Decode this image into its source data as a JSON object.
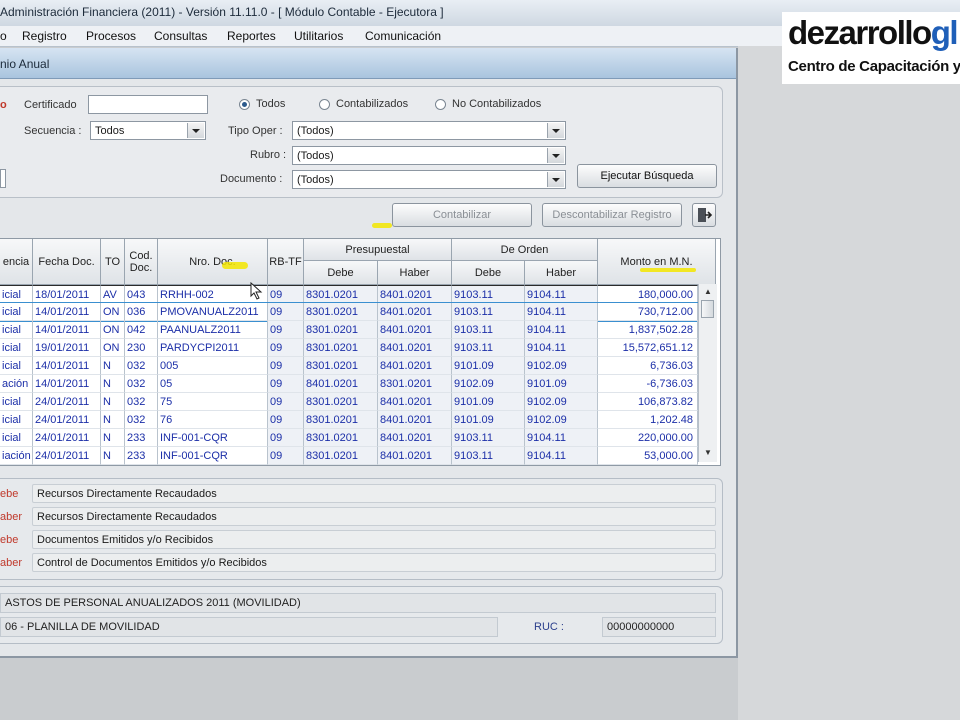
{
  "window": {
    "title": "Administración Financiera (2011) - Versión 11.11.0 - [ Módulo Contable - Ejecutora ]"
  },
  "menu": [
    "o",
    "Registro",
    "Procesos",
    "Consultas",
    "Reportes",
    "Utilitarios",
    "Comunicación"
  ],
  "child_window": {
    "title": "nio Anual"
  },
  "logo": {
    "main_a": "dezarrollo",
    "main_b": "gl",
    "sub": "Centro de Capacitación y"
  },
  "colors": {
    "cell_text": "#1c2fa8",
    "red_label": "#c0392b",
    "logo_accent": "#1f5fb8"
  },
  "filters": {
    "cut_label": "o",
    "certificado_label": "Certificado",
    "certificado_value": "",
    "secuencia_label": "Secuencia :",
    "secuencia_value": "Todos",
    "radio_todos": "Todos",
    "radio_contabilizados": "Contabilizados",
    "radio_no_contabilizados": "No Contabilizados",
    "tipo_oper_label": "Tipo Oper :",
    "tipo_oper_value": "(Todos)",
    "rubro_label": "Rubro :",
    "rubro_value": "(Todos)",
    "documento_label": "Documento :",
    "documento_value": "(Todos)",
    "search_button": "Ejecutar Búsqueda"
  },
  "actions": {
    "contabilizar": "Contabilizar",
    "descontabilizar": "Descontabilizar Registro"
  },
  "grid": {
    "headers": {
      "secuencia": "encia",
      "fecha_doc": "Fecha Doc.",
      "to": "TO",
      "cod_doc": "Cod. Doc.",
      "nro_doc": "Nro. Doc.",
      "rb_tf": "RB-TF",
      "presupuestal": "Presupuestal",
      "de_orden": "De Orden",
      "debe": "Debe",
      "haber": "Haber",
      "monto": "Monto en M.N."
    },
    "rows": [
      {
        "sec": "icial",
        "fecha": "18/01/2011",
        "to": "AV",
        "cod": "043",
        "nro": "RRHH-002",
        "rb": "09",
        "p_debe": "8301.0201",
        "p_haber": "8401.0201",
        "o_debe": "9103.11",
        "o_haber": "9104.11",
        "monto": "180,000.00"
      },
      {
        "sec": "icial",
        "fecha": "14/01/2011",
        "to": "ON",
        "cod": "036",
        "nro": "PMOVANUALZ2011",
        "rb": "09",
        "p_debe": "8301.0201",
        "p_haber": "8401.0201",
        "o_debe": "9103.11",
        "o_haber": "9104.11",
        "monto": "730,712.00"
      },
      {
        "sec": "icial",
        "fecha": "14/01/2011",
        "to": "ON",
        "cod": "042",
        "nro": "PAANUALZ2011",
        "rb": "09",
        "p_debe": "8301.0201",
        "p_haber": "8401.0201",
        "o_debe": "9103.11",
        "o_haber": "9104.11",
        "monto": "1,837,502.28"
      },
      {
        "sec": "icial",
        "fecha": "19/01/2011",
        "to": "ON",
        "cod": "230",
        "nro": "PARDYCPI2011",
        "rb": "09",
        "p_debe": "8301.0201",
        "p_haber": "8401.0201",
        "o_debe": "9103.11",
        "o_haber": "9104.11",
        "monto": "15,572,651.12"
      },
      {
        "sec": "icial",
        "fecha": "14/01/2011",
        "to": "N",
        "cod": "032",
        "nro": "005",
        "rb": "09",
        "p_debe": "8301.0201",
        "p_haber": "8401.0201",
        "o_debe": "9101.09",
        "o_haber": "9102.09",
        "monto": "6,736.03"
      },
      {
        "sec": "ación",
        "fecha": "14/01/2011",
        "to": "N",
        "cod": "032",
        "nro": "05",
        "rb": "09",
        "p_debe": "8401.0201",
        "p_haber": "8301.0201",
        "o_debe": "9102.09",
        "o_haber": "9101.09",
        "monto": "-6,736.03"
      },
      {
        "sec": "icial",
        "fecha": "24/01/2011",
        "to": "N",
        "cod": "032",
        "nro": "75",
        "rb": "09",
        "p_debe": "8301.0201",
        "p_haber": "8401.0201",
        "o_debe": "9101.09",
        "o_haber": "9102.09",
        "monto": "106,873.82"
      },
      {
        "sec": "icial",
        "fecha": "24/01/2011",
        "to": "N",
        "cod": "032",
        "nro": "76",
        "rb": "09",
        "p_debe": "8301.0201",
        "p_haber": "8401.0201",
        "o_debe": "9101.09",
        "o_haber": "9102.09",
        "monto": "1,202.48"
      },
      {
        "sec": "icial",
        "fecha": "24/01/2011",
        "to": "N",
        "cod": "233",
        "nro": "INF-001-CQR",
        "rb": "09",
        "p_debe": "8301.0201",
        "p_haber": "8401.0201",
        "o_debe": "9103.11",
        "o_haber": "9104.11",
        "monto": "220,000.00"
      },
      {
        "sec": "iación",
        "fecha": "24/01/2011",
        "to": "N",
        "cod": "233",
        "nro": "INF-001-CQR",
        "rb": "09",
        "p_debe": "8301.0201",
        "p_haber": "8401.0201",
        "o_debe": "9103.11",
        "o_haber": "9104.11",
        "monto": "53,000.00"
      }
    ]
  },
  "accounts": [
    {
      "type": "ebe",
      "desc": "Recursos Directamente Recaudados"
    },
    {
      "type": "aber",
      "desc": "Recursos Directamente Recaudados"
    },
    {
      "type": "ebe",
      "desc": "Documentos Emitidos y/o Recibidos"
    },
    {
      "type": "aber",
      "desc": "Control de Documentos Emitidos y/o Recibidos"
    }
  ],
  "info": {
    "line1": "ASTOS DE PERSONAL ANUALIZADOS 2011 (MOVILIDAD)",
    "line2": "06 - PLANILLA DE MOVILIDAD",
    "ruc_label": "RUC :",
    "ruc_value": "00000000000"
  }
}
